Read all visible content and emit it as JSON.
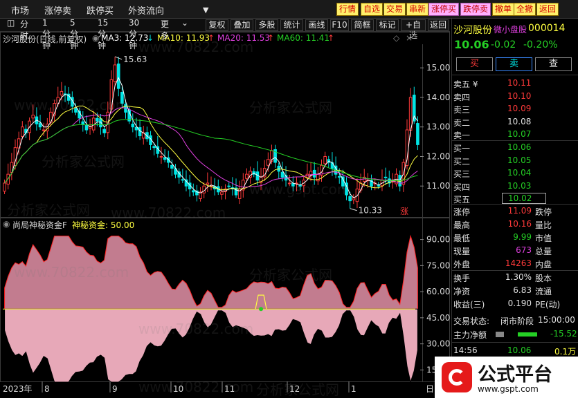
{
  "menu": [
    "市场",
    "涨停卖",
    "跌停买",
    "外资流向"
  ],
  "fn_buttons": [
    {
      "label": "行情",
      "style": "yellow"
    },
    {
      "label": "自选",
      "style": "yellow"
    },
    {
      "label": "交易",
      "style": "yellow"
    },
    {
      "label": "串新",
      "style": "yellow"
    },
    {
      "label": "涨停买",
      "style": "pink"
    },
    {
      "label": "跌停卖",
      "style": "pink"
    },
    {
      "label": "撤单",
      "style": "yellow"
    },
    {
      "label": "全撤",
      "style": "yellow"
    },
    {
      "label": "返回",
      "style": "yellow"
    }
  ],
  "toolbar": [
    "复权",
    "叠加",
    "多股",
    "统计",
    "画线",
    "F10",
    "简框",
    "标记",
    "+自选",
    "返回"
  ],
  "periods": [
    "分时",
    "1分钟",
    "5分钟",
    "15分钟",
    "30分钟",
    "更多"
  ],
  "header": {
    "name": "沙河股份(日线,前复权)",
    "ma3": "MA3: 12.73",
    "ma10": "MA10: 11.93",
    "ma20": "MA20: 11.53",
    "ma60": "MA60: 11.41"
  },
  "annotations": {
    "high": "15.63",
    "low": "10.33",
    "zhang": "涨"
  },
  "indicator": {
    "name": "尚局神秘资金F",
    "value_label": "神秘资金: 50.00"
  },
  "price_axis": [
    "15.00",
    "14.00",
    "13.00",
    "12.00",
    "11.00"
  ],
  "ind_axis": [
    "90.00",
    "75.00",
    "60.00",
    "45.00",
    "30.00",
    "15.00"
  ],
  "time_axis": [
    "2023年",
    "8",
    "9",
    "10",
    "11",
    "12",
    "1",
    "日"
  ],
  "stock": {
    "name": "沙河股份",
    "tag": "微小盘股",
    "code": "000014",
    "price": "10.06",
    "change": "-0.02",
    "pct": "-0.20%"
  },
  "trade_buttons": {
    "buy": "买",
    "sell": "卖",
    "check": "查"
  },
  "asks": [
    {
      "label": "卖五 ¥",
      "price": "10.11"
    },
    {
      "label": "卖四",
      "price": "10.10"
    },
    {
      "label": "卖三",
      "price": "10.09"
    },
    {
      "label": "卖二",
      "price": "10.08"
    },
    {
      "label": "卖一",
      "price": "10.07"
    }
  ],
  "bids": [
    {
      "label": "买一",
      "price": "10.06"
    },
    {
      "label": "买二",
      "price": "10.05"
    },
    {
      "label": "买三",
      "price": "10.04"
    },
    {
      "label": "买四",
      "price": "10.03"
    },
    {
      "label": "买五",
      "price": "10.02"
    }
  ],
  "stats": [
    {
      "l1": "涨停",
      "v1": "11.09",
      "l2": "跌停",
      "c1": "#ff3a3a"
    },
    {
      "l1": "最高",
      "v1": "10.16",
      "l2": "量比",
      "c1": "#ff3a3a"
    },
    {
      "l1": "最低",
      "v1": "9.99",
      "l2": "市值",
      "c1": "#25d025"
    },
    {
      "l1": "现量",
      "v1": "673",
      "l2": "总量",
      "c1": "#e040e0"
    },
    {
      "l1": "外盘",
      "v1": "14263",
      "l2": "内盘",
      "c1": "#ff3a3a"
    }
  ],
  "stats2": [
    {
      "l1": "换手",
      "v1": "1.30%",
      "l2": "股本"
    },
    {
      "l1": "净资",
      "v1": "6.83",
      "l2": "流通"
    },
    {
      "l1": "收益(三)",
      "v1": "0.190",
      "l2": "PE(动)"
    }
  ],
  "trade_state": {
    "label": "交易状态:",
    "value": "闭市阶段",
    "time": "15:00:00"
  },
  "main_net": {
    "label": "主力净额",
    "value": "-15.52"
  },
  "tick": {
    "time": "14:56",
    "price": "10.06",
    "vol": "0.1万"
  },
  "logo": {
    "big": "公式平台",
    "small": "www.gspt.com"
  },
  "watermarks": [
    "www.70822.com",
    "分析家公式网",
    "www.gspt.com"
  ],
  "colors": {
    "up": "#ff3a3a",
    "down": "#00e5e5",
    "ma3": "#ffffff",
    "ma10": "#ffff40",
    "ma20": "#e040e0",
    "ma60": "#25d025"
  },
  "chart_data": {
    "type": "candlestick",
    "y_range": [
      10.0,
      15.8
    ],
    "ind_range": [
      10,
      95
    ],
    "closes": [
      11.1,
      11.4,
      11.8,
      12.3,
      12.6,
      13.0,
      12.8,
      13.2,
      13.4,
      13.1,
      13.0,
      12.9,
      13.1,
      13.5,
      13.8,
      14.0,
      14.2,
      14.1,
      13.9,
      13.7,
      13.5,
      13.3,
      13.1,
      12.9,
      13.0,
      13.3,
      13.2,
      13.0,
      12.8,
      13.5,
      14.6,
      15.1,
      14.3,
      13.8,
      13.5,
      13.2,
      13.0,
      12.9,
      12.7,
      12.8,
      12.6,
      12.4,
      12.3,
      12.1,
      12.0,
      11.9,
      11.8,
      11.6,
      11.4,
      11.3,
      11.2,
      11.0,
      10.9,
      10.8,
      10.7,
      10.8,
      11.0,
      11.1,
      11.0,
      10.9,
      10.8,
      10.8,
      10.9,
      11.0,
      10.9,
      10.7,
      10.9,
      11.2,
      11.4,
      11.5,
      11.4,
      11.2,
      11.3,
      11.6,
      11.9,
      12.2,
      11.8,
      11.5,
      11.3,
      11.2,
      11.1,
      11.0,
      11.1,
      11.0,
      11.2,
      11.4,
      11.5,
      11.3,
      11.4,
      11.7,
      12.0,
      11.8,
      11.6,
      11.4,
      11.3,
      11.0,
      10.7,
      10.5,
      10.6,
      10.9,
      11.1,
      11.3,
      11.2,
      11.0,
      11.1,
      11.0,
      11.2,
      11.3,
      11.1,
      11.2,
      11.4,
      11.0,
      11.8,
      12.9,
      14.0,
      13.2,
      12.4
    ]
  }
}
